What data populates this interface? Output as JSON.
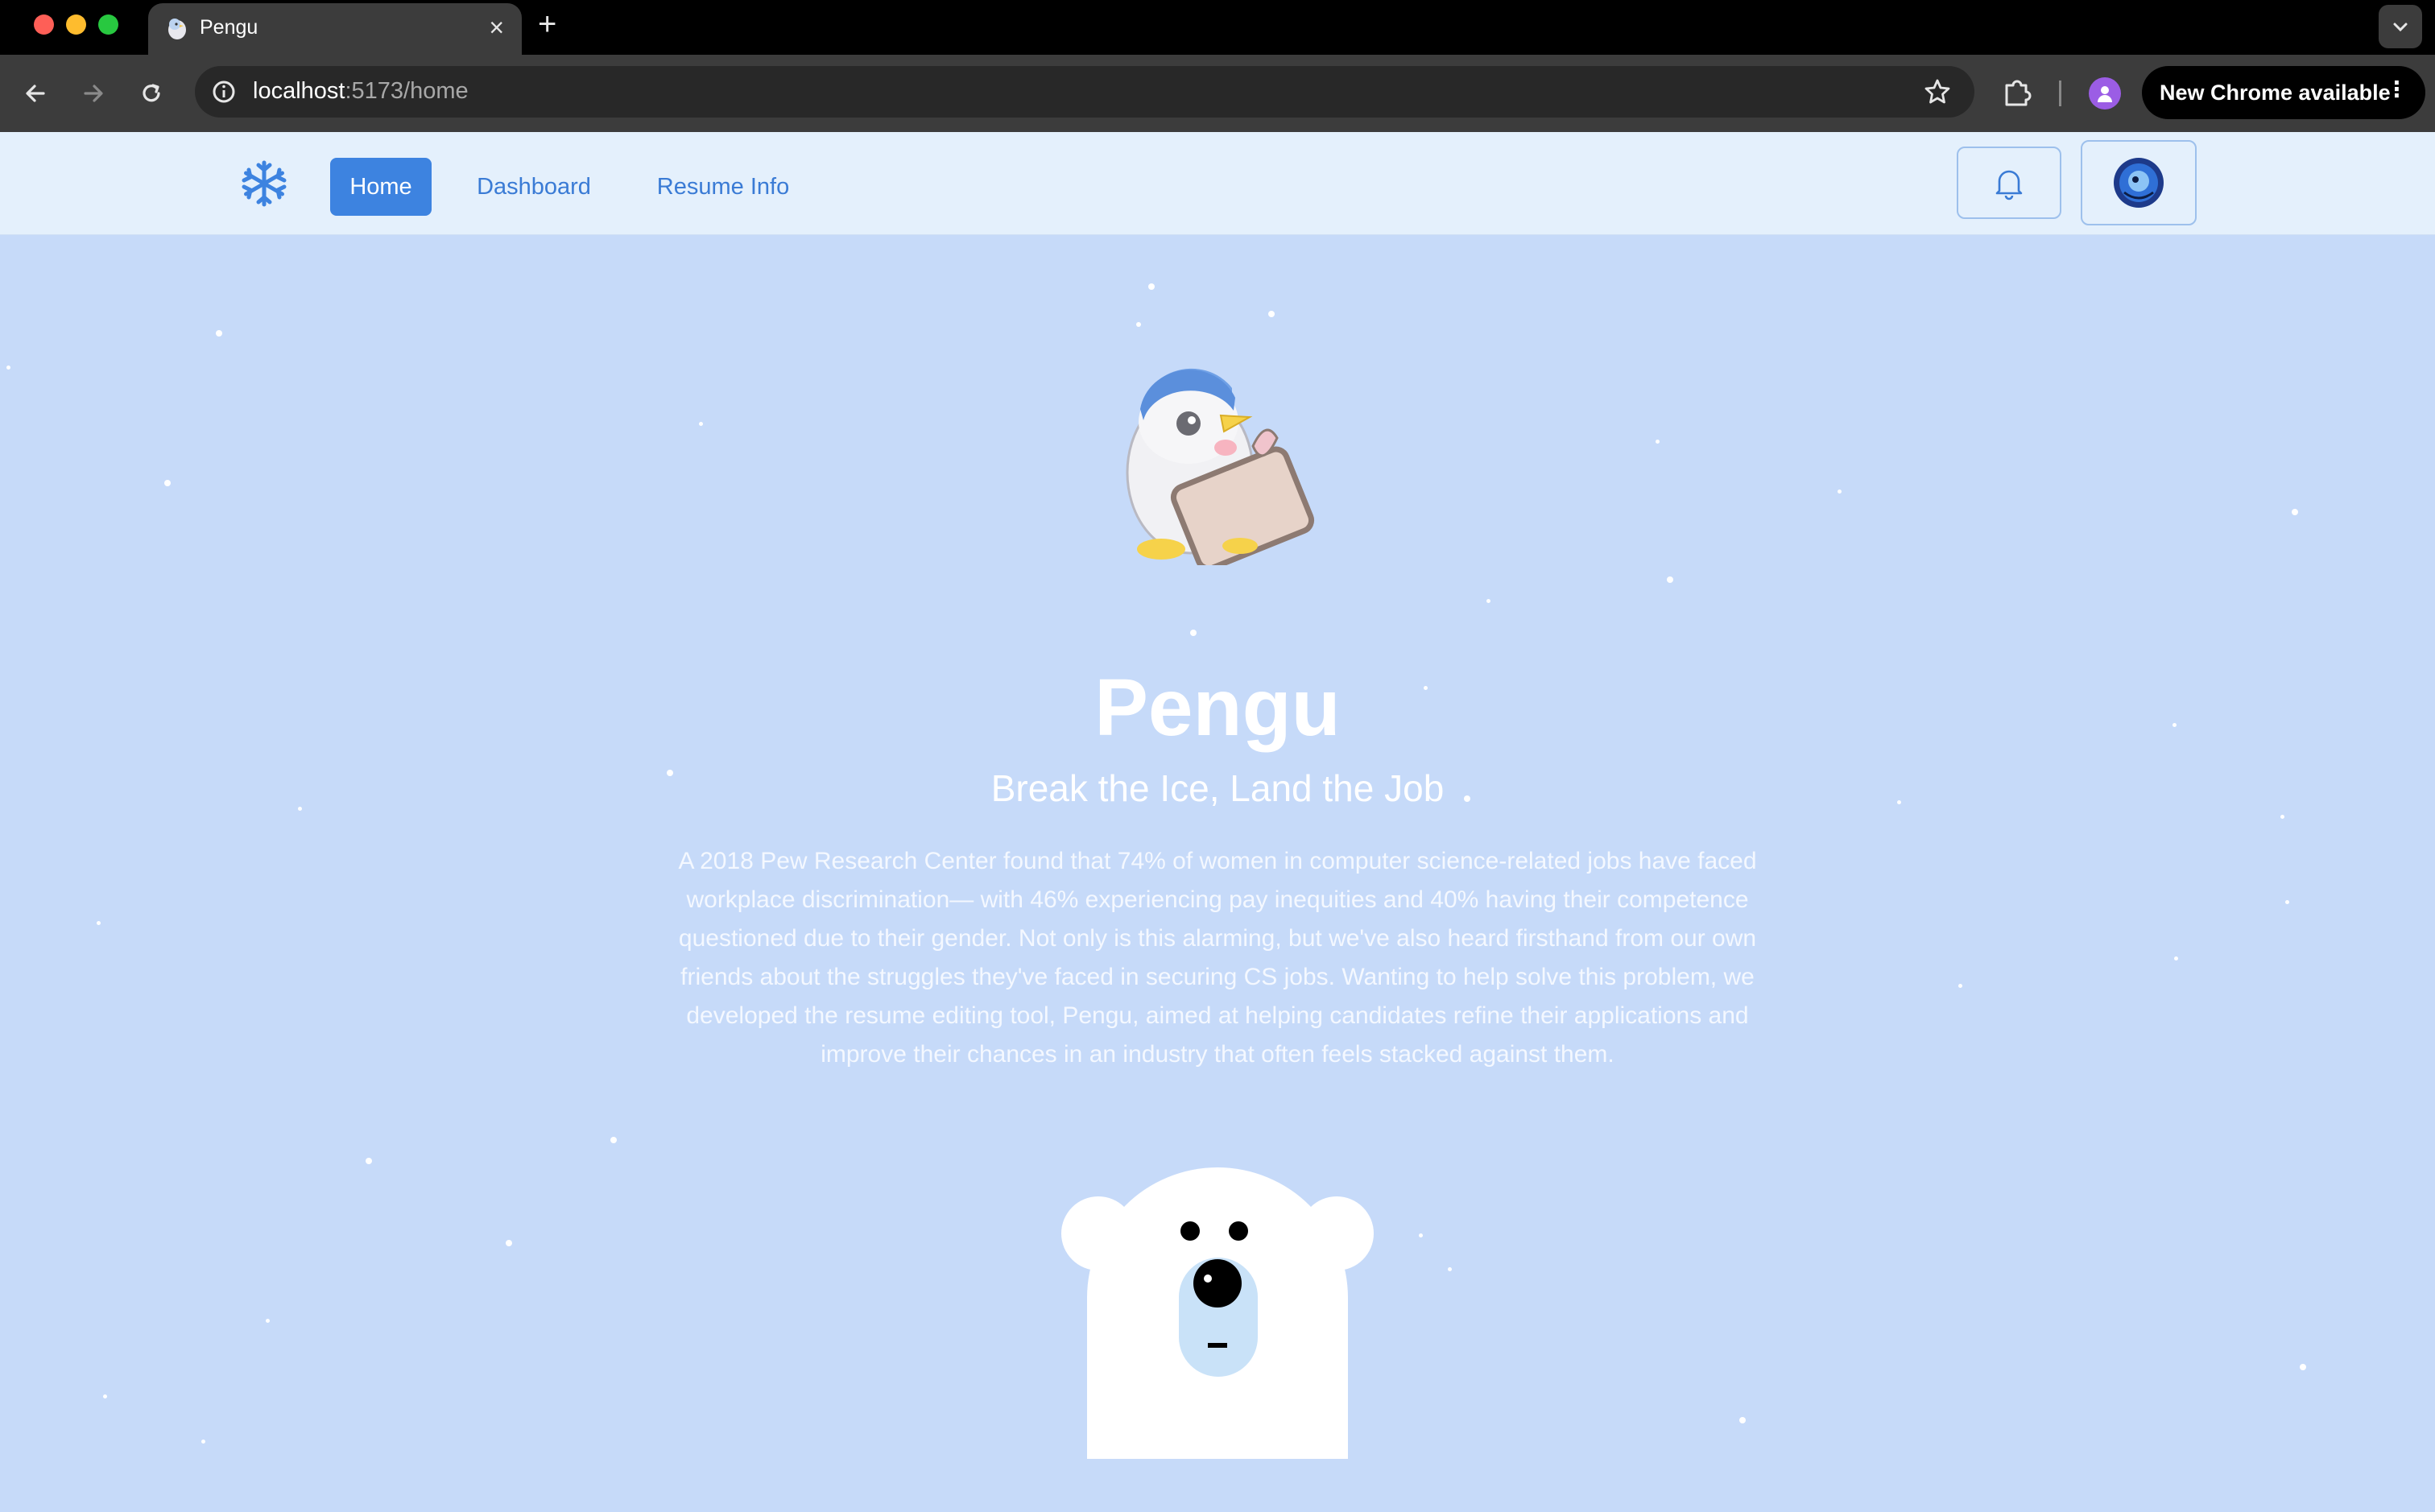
{
  "browser": {
    "tab_title": "Pengu",
    "tab_close": "×",
    "new_tab": "+",
    "url_host": "localhost",
    "url_path": ":5173/home",
    "update_label": "New Chrome available",
    "update_menu": "⋮"
  },
  "nav": {
    "home": "Home",
    "dashboard": "Dashboard",
    "resume_info": "Resume Info"
  },
  "hero": {
    "title": "Pengu",
    "subtitle": "Break the Ice, Land the Job",
    "body": "A 2018 Pew Research Center found that 74% of women in computer science-related jobs have faced workplace discrimination— with 46% experiencing pay inequities and 40% having their competence questioned due to their gender. Not only is this alarming, but we've also heard firsthand from our own friends about the struggles they've faced in securing CS jobs. Wanting to help solve this problem, we developed the resume editing tool, Pengu, aimed at helping candidates refine their applications and improve their chances in an industry that often feels stacked against them."
  },
  "colors": {
    "page_background": "#c6daf9",
    "nav_background": "#e4f0fc",
    "accent": "#3d83e0",
    "link": "#3a7bd5"
  },
  "icons": {
    "logo": "snowflake-icon",
    "bell": "bell-icon",
    "avatar": "avatar-icon",
    "back": "arrow-left-icon",
    "forward": "arrow-right-icon",
    "reload": "reload-icon",
    "star": "star-icon",
    "extensions": "puzzle-icon"
  }
}
